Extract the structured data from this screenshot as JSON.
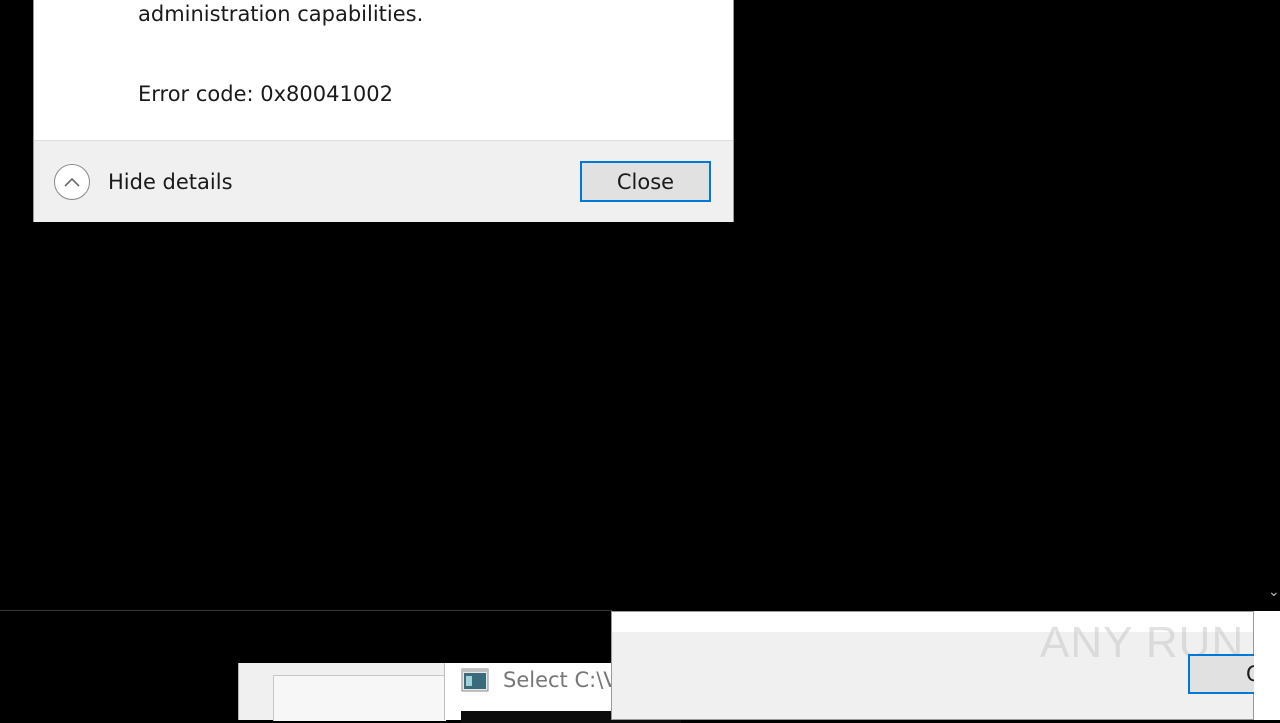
{
  "error_dialog": {
    "message_tail": "administration capabilities.",
    "error_code": "Error code: 0x80041002",
    "hide_details_label": "Hide details",
    "close_label": "Close"
  },
  "taskbar": {
    "select_window_title": "Select C:\\V"
  },
  "second_dialog": {
    "button_label": "OK"
  },
  "watermark": {
    "text": "ANY RUN"
  },
  "colors": {
    "accent": "#0078d7",
    "dialog_footer": "#f0f0f0",
    "desktop": "#000000"
  }
}
